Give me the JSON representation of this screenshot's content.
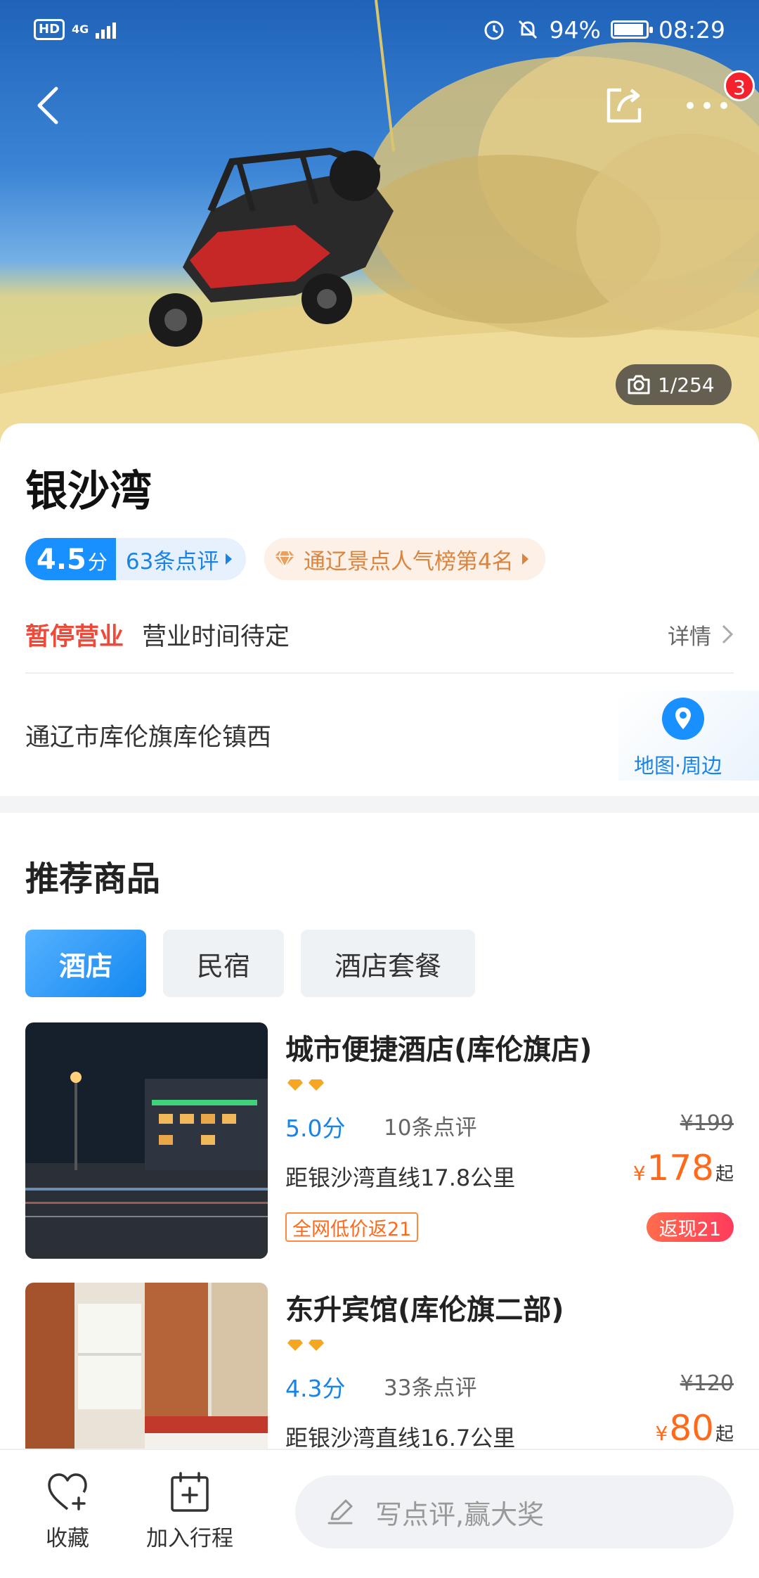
{
  "status_bar": {
    "hd": "HD",
    "network": "4G",
    "battery": "94%",
    "battery_level": 0.94,
    "time": "08:29"
  },
  "header": {
    "notification_count": "3",
    "photo_counter": "1/254"
  },
  "attraction": {
    "name": "银沙湾",
    "score": "4.5",
    "score_unit": "分",
    "review_count": "63条点评",
    "ranking": "通辽景点人气榜第4名",
    "status": "暂停营业",
    "hours": "营业时间待定",
    "details_label": "详情",
    "address": "通辽市库伦旗库伦镇西",
    "map_label": "地图·周边"
  },
  "recommend": {
    "title": "推荐商品",
    "tabs": [
      {
        "label": "酒店",
        "active": true
      },
      {
        "label": "民宿",
        "active": false
      },
      {
        "label": "酒店套餐",
        "active": false
      }
    ],
    "items": [
      {
        "name": "城市便捷酒店(库伦旗店)",
        "diamonds": 2,
        "score": "5.0分",
        "reviews": "10条点评",
        "original_price": "¥199",
        "distance": "距银沙湾直线17.8公里",
        "currency": "¥",
        "price": "178",
        "price_suffix": "起",
        "promo": "全网低价返21",
        "cashback": "返现21"
      },
      {
        "name": "东升宾馆(库伦旗二部)",
        "diamonds": 2,
        "score": "4.3分",
        "reviews": "33条点评",
        "original_price": "¥120",
        "distance": "距银沙湾直线16.7公里",
        "currency": "¥",
        "price": "80",
        "price_suffix": "起"
      }
    ]
  },
  "bottom_bar": {
    "favorite_label": "收藏",
    "add_trip_label": "加入行程",
    "review_placeholder": "写点评,赢大奖"
  },
  "colors": {
    "accent_blue": "#1890ff",
    "closed_red": "#ee4a3a",
    "price_orange": "#ff6a1a",
    "diamond_gold": "#f5a623"
  },
  "icons": [
    "back-icon",
    "share-icon",
    "more-icon",
    "camera-icon",
    "diamond-icon",
    "location-pin-icon",
    "heart-add-icon",
    "calendar-add-icon",
    "pencil-icon"
  ]
}
